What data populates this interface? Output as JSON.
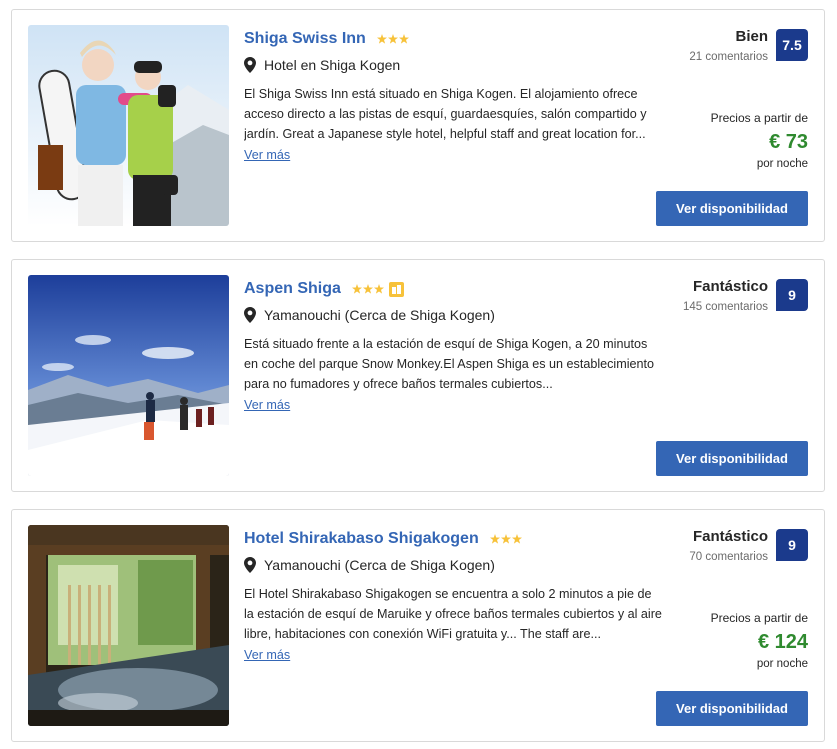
{
  "colors": {
    "link": "#3466b5",
    "score_bg": "#1b3a8c",
    "price": "#2f8a2f",
    "star": "#f7c23a",
    "button": "#3466b5"
  },
  "hotels": [
    {
      "name": "Shiga Swiss Inn",
      "stars": 3,
      "location": "Hotel en Shiga Kogen",
      "description": "El Shiga Swiss Inn está situado en Shiga Kogen. El alojamiento ofrece acceso directo a las pistas de esquí, guardaesquíes, salón compartido y jardín. Great a Japanese style hotel, helpful staff and great location for...",
      "more_label": "Ver más",
      "rating_word": "Bien",
      "reviews": "21 comentarios",
      "score": "7.5",
      "price_label": "Precios a partir de",
      "price": "€ 73",
      "per_night": "por noche",
      "cta": "Ver disponibilidad",
      "photo_icon": "skiers-photo"
    },
    {
      "name": "Aspen Shiga",
      "stars": 3,
      "badge_icon": "thumbs-up-icon",
      "location": "Yamanouchi (Cerca de Shiga Kogen)",
      "description": "Está situado frente a la estación de esquí de Shiga Kogen, a 20 minutos en coche del parque Snow Monkey.El Aspen Shiga es un establecimiento para no fumadores y ofrece baños termales cubiertos...",
      "more_label": "Ver más",
      "rating_word": "Fantástico",
      "reviews": "145 comentarios",
      "score": "9",
      "cta": "Ver disponibilidad",
      "photo_icon": "snow-mountain-photo"
    },
    {
      "name": "Hotel Shirakabaso Shigakogen",
      "stars": 3,
      "location": "Yamanouchi (Cerca de Shiga Kogen)",
      "description": "El Hotel Shirakabaso Shigakogen se encuentra a solo 2 minutos a pie de la estación de esquí de Maruike y ofrece baños termales cubiertos y al aire libre, habitaciones con conexión WiFi gratuita y... The staff are...",
      "more_label": "Ver más",
      "rating_word": "Fantástico",
      "reviews": "70 comentarios",
      "score": "9",
      "price_label": "Precios a partir de",
      "price": "€ 124",
      "per_night": "por noche",
      "cta": "Ver disponibilidad",
      "photo_icon": "onsen-bath-photo"
    }
  ]
}
